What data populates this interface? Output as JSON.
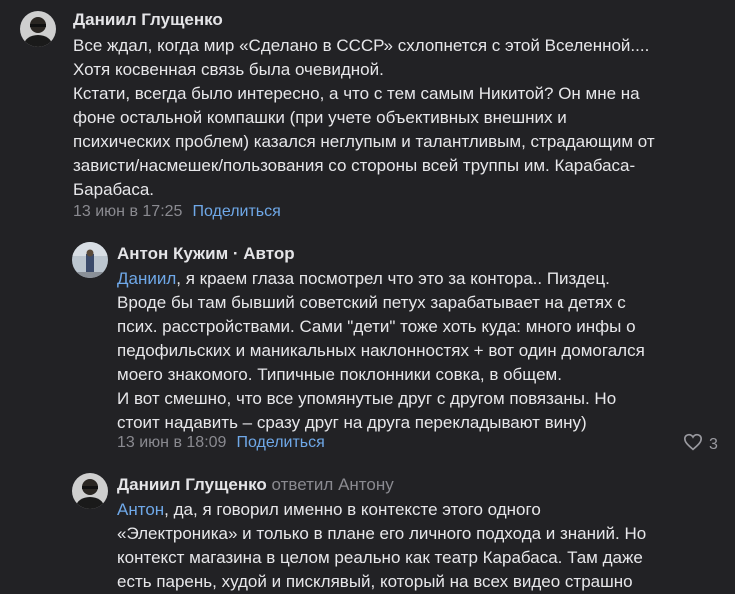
{
  "comments": [
    {
      "author": "Даниил Глущенко",
      "lines": [
        "Все ждал, когда мир «Сделано в СССР» схлопнется с этой Вселенной....",
        "Хотя косвенная связь была очевидной.",
        "Кстати, всегда было интересно, а что с тем самым Никитой? Он мне на",
        "фоне остальной компашки (при учете объективных внешних и",
        "психических проблем) казался неглупым и талантливым, страдающим от",
        "зависти/насмешек/пользования со стороны всей труппы им. Карабаса-",
        "Барабаса."
      ],
      "date": "13 июн в 17:25",
      "share": "Поделиться"
    },
    {
      "author": "Антон Кужим",
      "author_badge": "Автор",
      "mention": "Даниил",
      "first_line_rest": ", я краем глаза посмотрел что это за контора.. Пиздец.",
      "lines": [
        "Вроде бы там бывший советский петух зарабатывает на детях с",
        "псих. расстройствами. Сами \"дети\" тоже хоть куда: много инфы о",
        "педофильских и маникальных наклонностях + вот один домогался",
        "моего знакомого. Типичные поклонники совка, в общем.",
        "И вот смешно, что все упомянутые друг с другом повязаны. Но",
        "стоит надавить – сразу друг на друга перекладывают вину)"
      ],
      "date": "13 июн в 18:09",
      "share": "Поделиться",
      "likes": "3"
    },
    {
      "author": "Даниил Глущенко",
      "replied_to": "ответил Антону",
      "mention": "Антон",
      "first_line_rest": ", да, я говорил именно в контексте этого одного",
      "lines": [
        "«Электроника» и только в плане его личного подхода и знаний. Но",
        "контекст магазина в целом реально как театр Карабаса. Там даже",
        "есть парень, худой и писклявый, который на всех видео страшно"
      ]
    }
  ],
  "colors": {
    "background": "#222225",
    "link": "#6fa8e8",
    "muted": "#8a8a90"
  }
}
